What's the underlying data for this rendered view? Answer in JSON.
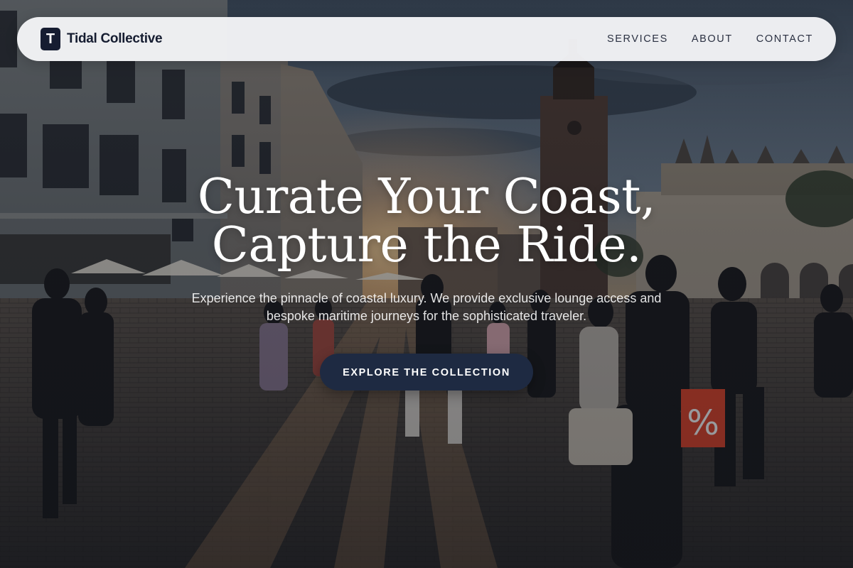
{
  "brand": {
    "mark": "T",
    "name": "Tidal Collective"
  },
  "nav": {
    "links": [
      "SERVICES",
      "ABOUT",
      "CONTACT"
    ]
  },
  "hero": {
    "title_line_1": "Curate Your Coast,",
    "title_line_2": "Capture the Ride.",
    "subtitle": "Experience the pinnacle of coastal luxury. We provide exclusive lounge access and bespoke maritime journeys for the sophisticated traveler.",
    "cta_label": "EXPLORE THE COLLECTION"
  },
  "colors": {
    "brand_navy": "#161d31",
    "cta_background": "#1e2a42",
    "nav_background": "#f4f5f7",
    "hero_text": "#ffffff"
  },
  "icons": {
    "brand_logo": "letter-t-logo-icon"
  }
}
